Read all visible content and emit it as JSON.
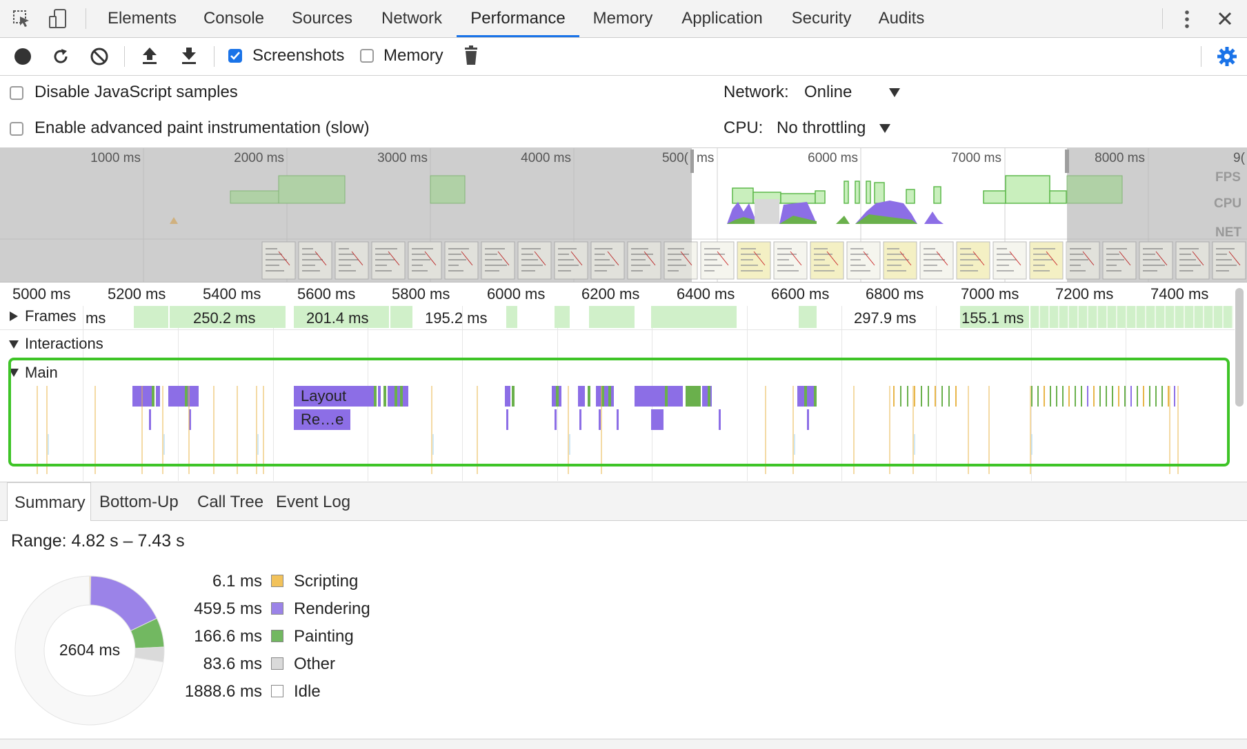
{
  "devtools_tabs": [
    {
      "label": "Elements"
    },
    {
      "label": "Console"
    },
    {
      "label": "Sources"
    },
    {
      "label": "Network"
    },
    {
      "label": "Performance"
    },
    {
      "label": "Memory"
    },
    {
      "label": "Application"
    },
    {
      "label": "Security"
    },
    {
      "label": "Audits"
    }
  ],
  "active_tab": "Performance",
  "toolbar": {
    "screenshots_label": "Screenshots",
    "screenshots_checked": true,
    "memory_label": "Memory",
    "memory_checked": false
  },
  "settings": {
    "disable_js_samples": "Disable JavaScript samples",
    "advanced_paint": "Enable advanced paint instrumentation (slow)",
    "network_label": "Network:",
    "network_value": "Online",
    "cpu_label": "CPU:",
    "cpu_value": "No throttling"
  },
  "overview": {
    "ticks": [
      "1000 ms",
      "2000 ms",
      "3000 ms",
      "4000 ms",
      "500(",
      "ms",
      "6000 ms",
      "7000 ms",
      "8000 ms",
      "9("
    ],
    "labels": {
      "fps": "FPS",
      "cpu": "CPU",
      "net": "NET"
    }
  },
  "ruler": {
    "ticks": [
      "5000 ms",
      "5200 ms",
      "5400 ms",
      "5600 ms",
      "5800 ms",
      "6000 ms",
      "6200 ms",
      "6400 ms",
      "6600 ms",
      "6800 ms",
      "7000 ms",
      "7200 ms",
      "7400 ms"
    ]
  },
  "tracks": {
    "frames": "Frames",
    "frames_values": [
      "ms",
      "250.2 ms",
      "201.4 ms",
      "195.2 ms",
      "297.9 ms",
      "155.1 ms"
    ],
    "interactions": "Interactions",
    "main": "Main",
    "main_events": {
      "layout": "Layout",
      "recalc": "Re…e"
    }
  },
  "bottom_tabs": [
    {
      "label": "Summary"
    },
    {
      "label": "Bottom-Up"
    },
    {
      "label": "Call Tree"
    },
    {
      "label": "Event Log"
    }
  ],
  "summary": {
    "range": "Range: 4.82 s – 7.43 s",
    "total": "2604 ms",
    "legend": [
      {
        "value": "6.1 ms",
        "name": "Scripting",
        "color": "#f2c25a"
      },
      {
        "value": "459.5 ms",
        "name": "Rendering",
        "color": "#9b83e8"
      },
      {
        "value": "166.6 ms",
        "name": "Painting",
        "color": "#72b861"
      },
      {
        "value": "83.6 ms",
        "name": "Other",
        "color": "#dadada"
      },
      {
        "value": "1888.6 ms",
        "name": "Idle",
        "color": "#ffffff"
      }
    ]
  },
  "colors": {
    "accent": "#1a73e8",
    "highlight": "#3ec427",
    "rendering": "#8c6ee6",
    "painting": "#6ab04c",
    "scripting": "#e8b64a",
    "frame": "#d0f0c9"
  }
}
